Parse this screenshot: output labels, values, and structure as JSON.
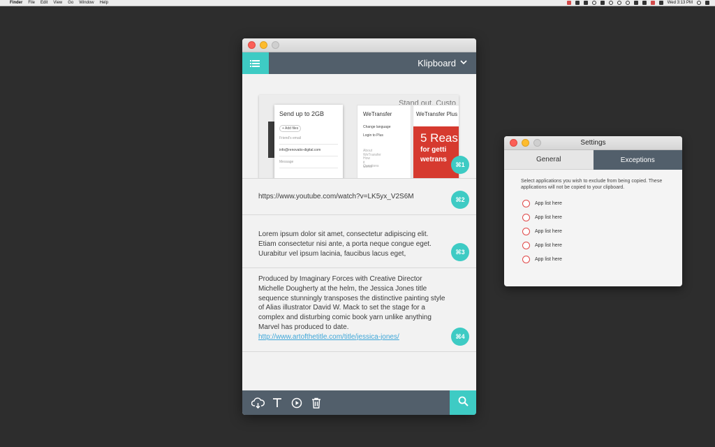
{
  "menubar": {
    "apple": "",
    "app": "Finder",
    "menus": [
      "File",
      "Edit",
      "View",
      "Go",
      "Window",
      "Help"
    ],
    "clock": "Wed 3:13 PM"
  },
  "klipboard": {
    "title": "Klipboard",
    "clips": [
      {
        "type": "image",
        "badge": "⌘1",
        "preview": {
          "tag": "Stand out. Custo",
          "card1_title": "Send up to 2GB",
          "card1_add": "+ Add files",
          "card1_friend": "Friend's email",
          "card1_email": "info@renovatio-digital.com",
          "card1_message": "Message",
          "card2_title": "WeTransfer",
          "card2_items": [
            "Change language",
            "Login to Plus"
          ],
          "card2_items_light": [
            "About WeTransfer",
            "How it works",
            "Questions"
          ],
          "card3_title": "WeTransfer Plus",
          "ad_big": "5 Reas",
          "ad_small1": "for getti",
          "ad_small2": "wetrans"
        }
      },
      {
        "type": "text",
        "badge": "⌘2",
        "text": "https://www.youtube.com/watch?v=LK5yx_V2S6M"
      },
      {
        "type": "text",
        "badge": "⌘3",
        "text": "Lorem ipsum dolor sit amet, consectetur adipiscing elit. Etiam consectetur nisi ante, a porta neque congue eget. Uurabitur vel ipsum lacinia, faucibus lacus eget,"
      },
      {
        "type": "text",
        "badge": "⌘4",
        "text": "Produced by Imaginary Forces with Creative Director Michelle Dougherty at the helm, the Jessica Jones title sequence stunningly transposes the distinctive painting style of Alias illustrator David W. Mack to set the stage for a complex and disturbing comic book yarn unlike anything Marvel has produced to date.",
        "link": "http://www.artofthetitle.com/title/jessica-jones/"
      }
    ],
    "footer_tools": [
      "cloud-icon",
      "text-icon",
      "play-icon",
      "trash-icon"
    ],
    "accent": "#3ecbc4",
    "header_color": "#525f6b"
  },
  "settings": {
    "title": "Settings",
    "tabs": [
      {
        "label": "General",
        "active": false
      },
      {
        "label": "Exceptions",
        "active": true
      }
    ],
    "description": "Select applications you wish to exclude from being copied. These applications will not be copied to your clipboard.",
    "apps": [
      "App list here",
      "App list here",
      "App list here",
      "App list here",
      "App list here"
    ]
  }
}
